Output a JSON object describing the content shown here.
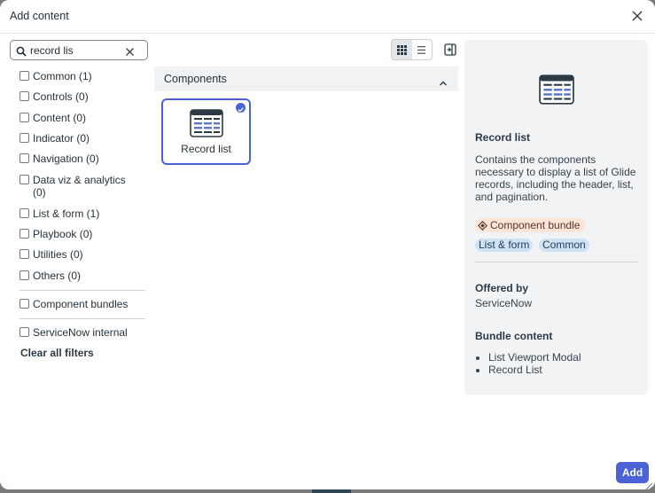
{
  "dialog": {
    "title": "Add content"
  },
  "search": {
    "value": "record lis",
    "placeholder": "Search"
  },
  "filters": [
    {
      "label": "Common (1)"
    },
    {
      "label": "Controls (0)"
    },
    {
      "label": "Content (0)"
    },
    {
      "label": "Indicator (0)"
    },
    {
      "label": "Navigation (0)"
    },
    {
      "label": "Data viz & analytics (0)"
    },
    {
      "label": "List & form (1)"
    },
    {
      "label": "Playbook (0)"
    },
    {
      "label": "Utilities (0)"
    },
    {
      "label": "Others (0)"
    }
  ],
  "extra_filters": {
    "component_bundles": "Component bundles",
    "servicenow_internal": "ServiceNow internal"
  },
  "clear_all": "Clear all filters",
  "view": {
    "mode": "grid"
  },
  "section": {
    "title": "Components",
    "expanded": true
  },
  "cards": [
    {
      "label": "Record list",
      "selected": true
    }
  ],
  "detail": {
    "title": "Record list",
    "description": "Contains the components necessary to display a list of Glide records, including the header, list, and pagination.",
    "bundle_badge": "Component bundle",
    "tags": [
      "List & form",
      "Common"
    ],
    "offered_by_label": "Offered by",
    "offered_by": "ServiceNow",
    "bundle_content_label": "Bundle content",
    "bundle_content": [
      "List Viewport Modal",
      "Record List"
    ]
  },
  "actions": {
    "add": "Add"
  },
  "colors": {
    "accent": "#4b63d6",
    "bundle_badge_bg": "#fbe4d8",
    "tag_bg": "#cfe3f4",
    "panel_bg": "#f2f3f4"
  }
}
